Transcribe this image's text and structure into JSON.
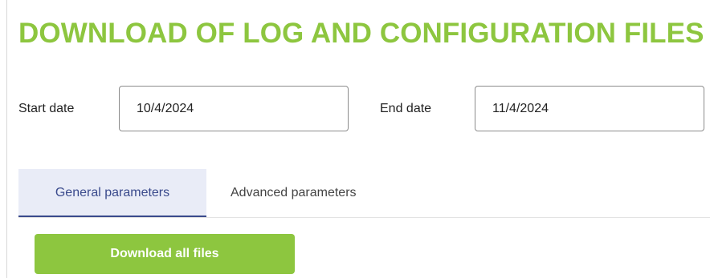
{
  "header": {
    "title": "DOWNLOAD OF LOG AND CONFIGURATION FILES"
  },
  "date_range": {
    "start_label": "Start date",
    "start_value": "10/4/2024",
    "end_label": "End date",
    "end_value": "11/4/2024"
  },
  "tabs": [
    {
      "label": "General parameters",
      "active": true
    },
    {
      "label": "Advanced parameters",
      "active": false
    }
  ],
  "actions": {
    "download_all_label": "Download all files"
  },
  "colors": {
    "accent_green": "#8dc63f",
    "active_tab_text": "#3a4a8c",
    "active_tab_bg": "#e9ecf7"
  }
}
